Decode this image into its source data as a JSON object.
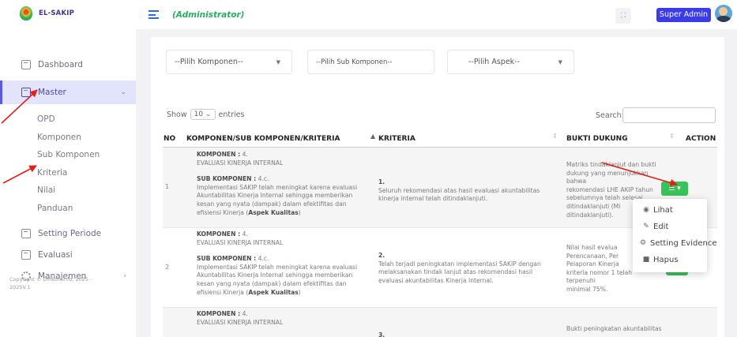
{
  "brand": {
    "name": "EL-SAKIP"
  },
  "header": {
    "role": "(Administrator)",
    "user_button": "Super Admin"
  },
  "sidebar": {
    "items": [
      {
        "label": "Dashboard"
      },
      {
        "label": "Master"
      }
    ],
    "submenu": [
      "OPD",
      "Komponen",
      "Sub Komponen",
      "Kriteria",
      "Nilai",
      "Panduan"
    ],
    "bottom_items": [
      {
        "label": "Setting Periode"
      },
      {
        "label": "Evaluasi"
      },
      {
        "label": "Manajemen"
      }
    ],
    "copyright_line1": "Copyright © Dinkominfo, 2025 -",
    "copyright_line2": "2025V.1"
  },
  "filters": {
    "komponen": "--Pilih Komponen--",
    "sub_komponen": "--Pilih Sub Komponen--",
    "aspek": "--Pilih Aspek--"
  },
  "table_controls": {
    "show": "Show",
    "entries_value": "10",
    "entries": "entries",
    "search_label": "Search:"
  },
  "table": {
    "headers": {
      "no": "NO",
      "komponen": "KOMPONEN/SUB KOMPONEN/KRITERIA",
      "kriteria": "KRITERIA",
      "bukti": "BUKTI DUKUNG",
      "action": "ACTION"
    },
    "rows": [
      {
        "no": "1",
        "komp_label": "KOMPONEN :",
        "komp_val": "4.",
        "komp_name": "EVALUASI KINERJA INTERNAL",
        "sub_label": "SUB KOMPONEN :",
        "sub_val": "4.c.",
        "sub_l1": "Implementasi SAKIP telah meningkat karena evaluasi",
        "sub_l2": "Akuntabilitas Kinerja Internal sehingga memberikan",
        "sub_l3": "kesan yang nyata (dampak) dalam efektifitas dan",
        "sub_l4a": "efisiensi Kinerja (",
        "sub_l4b": "Aspek Kualitas",
        "sub_l4c": ")",
        "krit_no": "1.",
        "krit_l1": "Seluruh rekomendasi atas hasil evaluasi akuntabilitas",
        "krit_l2": "kinerja internal telah ditindaklanjuti.",
        "bukti_l1": "Matriks tindaklanjut dan bukti",
        "bukti_l2": "dukung yang menunjukkan bahwa",
        "bukti_l3": "rekomendasi LHE AKIP tahun",
        "bukti_l4": "sebelumnya telah selesai",
        "bukti_l5": "ditindaklanjuti (Mi",
        "bukti_l6": "ditindaklanjuti)."
      },
      {
        "no": "2",
        "komp_label": "KOMPONEN :",
        "komp_val": "4.",
        "komp_name": "EVALUASI KINERJA INTERNAL",
        "sub_label": "SUB KOMPONEN :",
        "sub_val": "4.c.",
        "sub_l1": "Implementasi SAKIP telah meningkat karena evaluasi",
        "sub_l2": "Akuntabilitas Kinerja Internal sehingga memberikan",
        "sub_l3": "kesan yang nyata (dampak) dalam efektifitas dan",
        "sub_l4a": "efisiensi Kinerja (",
        "sub_l4b": "Aspek Kualitas",
        "sub_l4c": ")",
        "krit_no": "2.",
        "krit_l1": "Telah terjadi peningkatan implementasi SAKIP dengan",
        "krit_l2": "melaksanakan tindak lanjut atas rekomendasi hasil",
        "krit_l3": "evaluasi akuntabilitas Kinerja Internal.",
        "bukti_l1": "Nilai hasil evalua",
        "bukti_l2": "Perencanaan, Per",
        "bukti_l3": "Pelaporan Kinerja",
        "bukti_l4": "kriteria nomor 1 telah terpenuhi",
        "bukti_l5": "minimal 75%."
      },
      {
        "komp_label": "KOMPONEN :",
        "komp_val": "4.",
        "komp_name": "EVALUASI KINERJA INTERNAL",
        "krit_no": "3.",
        "bukti_l1": "Bukti peningkatan akuntabilitas"
      }
    ]
  },
  "dropdown": {
    "lihat": "Lihat",
    "edit": "Edit",
    "setting": "Setting Evidence",
    "hapus": "Hapus"
  },
  "colors": {
    "primary": "#3b3bea",
    "success": "#39c15a",
    "role": "#27ae60",
    "annotation": "#e0201c"
  }
}
